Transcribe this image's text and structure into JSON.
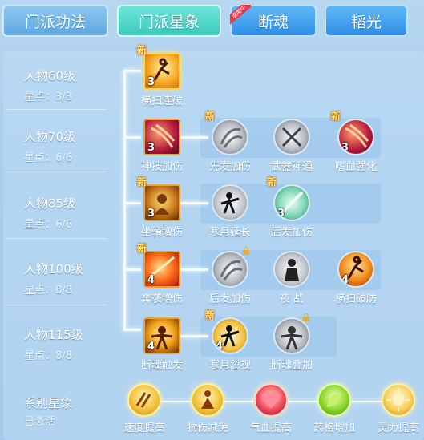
{
  "tabs": [
    {
      "label": "门派功法"
    },
    {
      "label": "门派星象"
    },
    {
      "label": "断魂",
      "badge": "使用中"
    },
    {
      "label": "韬光"
    }
  ],
  "rows": [
    {
      "level": "人物60级",
      "stars": "星点：3/3"
    },
    {
      "level": "人物70级",
      "stars": "星点：6/6"
    },
    {
      "level": "人物85级",
      "stars": "星点：6/6"
    },
    {
      "level": "人物100级",
      "stars": "星点：8/8"
    },
    {
      "level": "人物115级",
      "stars": "星点：8/8"
    }
  ],
  "skills": {
    "r1": [
      {
        "name": "横扫连破",
        "level": "3",
        "new": "新"
      }
    ],
    "r2": [
      {
        "name": "神技加伤",
        "level": "3"
      },
      {
        "name": "先发加伤",
        "new": "新"
      },
      {
        "name": "武器神通"
      },
      {
        "name": "嗜血强化",
        "level": "3",
        "new": "新"
      }
    ],
    "r3": [
      {
        "name": "坐骑增伤",
        "level": "3",
        "new": "新"
      },
      {
        "name": "寒月延长"
      },
      {
        "name": "后发加伤",
        "level": "3",
        "new": "新"
      }
    ],
    "r4": [
      {
        "name": "奔袭增伤",
        "level": "4",
        "new": "新"
      },
      {
        "name": "后发加伤"
      },
      {
        "name": "夜 战"
      },
      {
        "name": "横扫破防",
        "level": "4"
      }
    ],
    "r5": [
      {
        "name": "断魂触发",
        "level": "4"
      },
      {
        "name": "寒月忽视",
        "level": "4",
        "new": "新"
      },
      {
        "name": "断魂叠加"
      }
    ]
  },
  "series": {
    "title": "系别星象",
    "status": "已激活",
    "items": [
      {
        "name": "速度提高"
      },
      {
        "name": "物伤减免"
      },
      {
        "name": "气血提高"
      },
      {
        "name": "药格增加"
      },
      {
        "name": "灵力提高"
      }
    ]
  },
  "colors": {
    "active_tab": "#39c9bc",
    "accent_blue": "#2f8fe6",
    "badge": "#e93a4c",
    "gold": "#f3c23b"
  }
}
